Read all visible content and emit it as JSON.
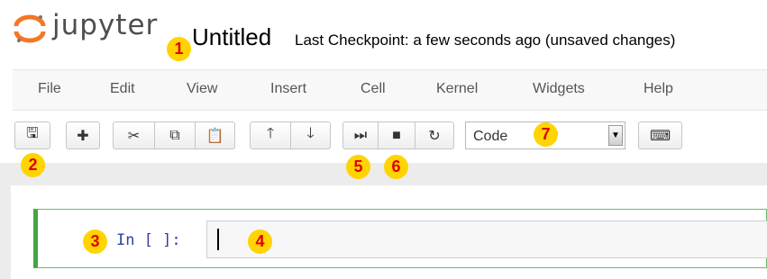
{
  "header": {
    "logo_text": "jupyter",
    "notebook_title": "Untitled",
    "checkpoint_status": "Last Checkpoint: a few seconds ago (unsaved changes)"
  },
  "menubar": {
    "items": [
      "File",
      "Edit",
      "View",
      "Insert",
      "Cell",
      "Kernel",
      "Widgets",
      "Help"
    ]
  },
  "toolbar": {
    "buttons": [
      {
        "name": "save",
        "icon": "floppy-disk-icon",
        "glyph": "🖫"
      },
      {
        "name": "insert-cell-below",
        "icon": "plus-icon",
        "glyph": "✚"
      },
      {
        "name": "cut",
        "icon": "scissors-icon",
        "glyph": "✂"
      },
      {
        "name": "copy",
        "icon": "copy-icon",
        "glyph": "⧉"
      },
      {
        "name": "paste",
        "icon": "paste-icon",
        "glyph": "📋"
      },
      {
        "name": "move-up",
        "icon": "arrow-up-icon",
        "glyph": "🡑"
      },
      {
        "name": "move-down",
        "icon": "arrow-down-icon",
        "glyph": "🡓"
      },
      {
        "name": "run",
        "icon": "step-forward-icon",
        "glyph": "⏭"
      },
      {
        "name": "interrupt",
        "icon": "stop-icon",
        "glyph": "■"
      },
      {
        "name": "restart",
        "icon": "refresh-icon",
        "glyph": "↻"
      },
      {
        "name": "command-palette",
        "icon": "keyboard-icon",
        "glyph": "⌨"
      }
    ],
    "cell_type": "Code"
  },
  "cell": {
    "prompt": "In [ ]:",
    "content": ""
  },
  "annotations": [
    "1",
    "2",
    "3",
    "4",
    "5",
    "6",
    "7"
  ],
  "colors": {
    "logo_orange": "#f37726",
    "prompt_blue": "#303f9f",
    "selected_cell_green": "#42a642",
    "badge_yellow": "#ffd400",
    "badge_text_red": "#e00000"
  }
}
